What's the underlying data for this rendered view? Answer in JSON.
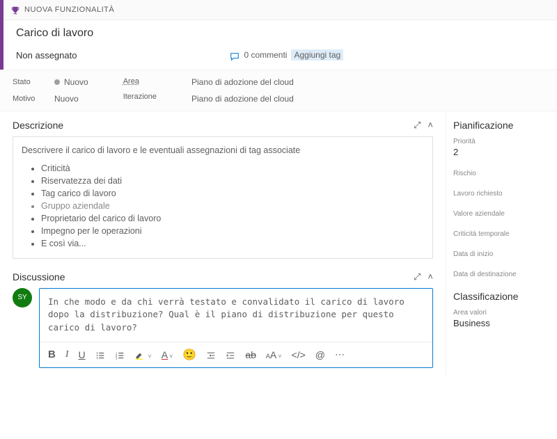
{
  "header": {
    "type_label": "NUOVA FUNZIONALITÀ",
    "title": "Carico di lavoro",
    "assignee": "Non assegnato",
    "comments_count": "0 commenti",
    "add_tag": "Aggiungi tag"
  },
  "fields": {
    "state_label": "Stato",
    "state_value": "Nuovo",
    "reason_label": "Motivo",
    "reason_value": "Nuovo",
    "area_label": "Area",
    "area_value": "Piano di adozione del cloud",
    "iteration_label": "Iterazione",
    "iteration_value": "Piano di adozione del cloud"
  },
  "description": {
    "title": "Descrizione",
    "intro": "Descrivere il carico di lavoro e le eventuali assegnazioni di tag associate",
    "items": [
      {
        "text": "Criticità",
        "light": false
      },
      {
        "text": "Riservatezza dei dati",
        "light": false
      },
      {
        "text": "Tag carico di lavoro",
        "light": false
      },
      {
        "text": "Gruppo aziendale",
        "light": true
      },
      {
        "text": "Proprietario del carico di lavoro",
        "light": false
      },
      {
        "text": "Impegno per le operazioni",
        "light": false
      },
      {
        "text": "E così via...",
        "light": false
      }
    ]
  },
  "discussion": {
    "title": "Discussione",
    "avatar": "SY",
    "text": "In che modo e da chi verrà testato e convalidato il carico di lavoro dopo la distribuzione? Qual è il piano di distribuzione per questo carico di lavoro?"
  },
  "planning": {
    "title": "Pianificazione",
    "priority_label": "Priorità",
    "priority_value": "2",
    "risk_label": "Rischio",
    "effort_label": "Lavoro richiesto",
    "business_value_label": "Valore aziendale",
    "time_crit_label": "Criticità temporale",
    "start_date_label": "Data di inizio",
    "target_date_label": "Data di destinazione"
  },
  "classification": {
    "title": "Classificazione",
    "value_area_label": "Area valori",
    "value_area_value": "Business"
  }
}
